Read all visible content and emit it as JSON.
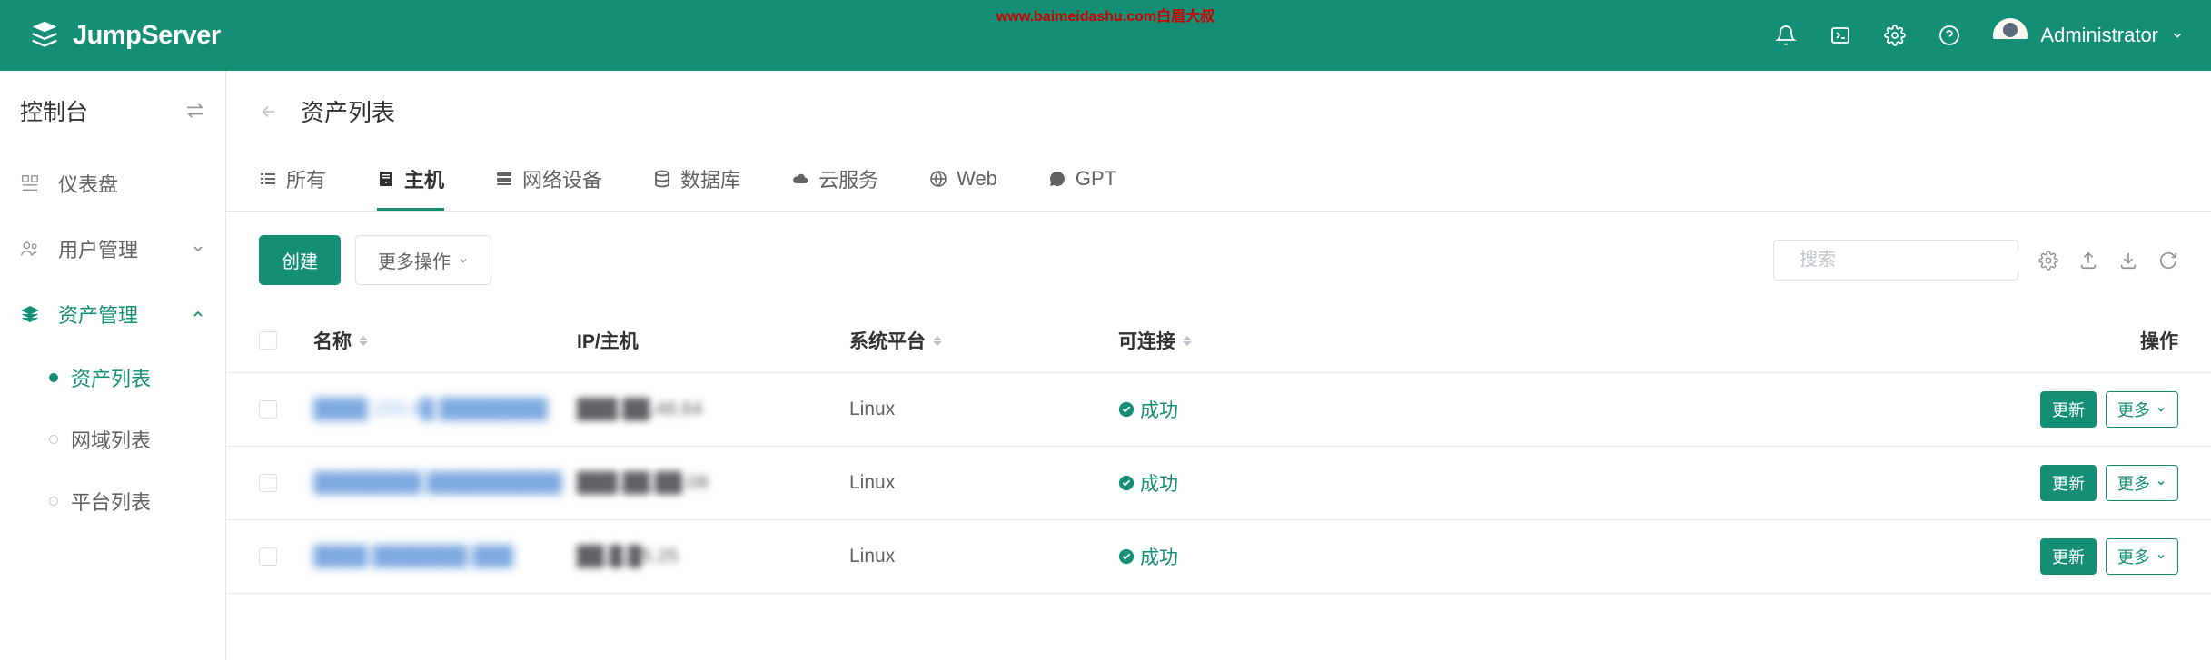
{
  "watermark": "www.baimeidashu.com白眉大叔",
  "header": {
    "logo_text": "JumpServer",
    "username": "Administrator"
  },
  "sidebar": {
    "header": "控制台",
    "items": [
      {
        "label": "仪表盘",
        "icon": "dashboard"
      },
      {
        "label": "用户管理",
        "icon": "users",
        "expandable": true
      },
      {
        "label": "资产管理",
        "icon": "layers",
        "expandable": true,
        "active": true
      }
    ],
    "sub_items": [
      {
        "label": "资产列表",
        "active": true
      },
      {
        "label": "网域列表"
      },
      {
        "label": "平台列表"
      }
    ]
  },
  "page": {
    "title": "资产列表"
  },
  "tabs": [
    {
      "label": "所有",
      "icon": "list"
    },
    {
      "label": "主机",
      "icon": "host",
      "active": true
    },
    {
      "label": "网络设备",
      "icon": "network"
    },
    {
      "label": "数据库",
      "icon": "database"
    },
    {
      "label": "云服务",
      "icon": "cloud"
    },
    {
      "label": "Web",
      "icon": "globe"
    },
    {
      "label": "GPT",
      "icon": "chat"
    }
  ],
  "toolbar": {
    "create_label": "创建",
    "more_label": "更多操作",
    "search_placeholder": "搜索"
  },
  "table": {
    "columns": {
      "name": "名称",
      "ip": "IP/主机",
      "platform": "系统平台",
      "connectable": "可连接",
      "actions": "操作"
    },
    "rows": [
      {
        "name": "████ 153.4█ ████████",
        "ip": "███.██.48.64",
        "platform": "Linux",
        "status": "成功"
      },
      {
        "name": "████████.██████████",
        "ip": "███.██.██.08",
        "platform": "Linux",
        "status": "成功"
      },
      {
        "name": "████.███████.███",
        "ip": "██.█.█5.25",
        "platform": "Linux",
        "status": "成功"
      }
    ],
    "action_update": "更新",
    "action_more": "更多"
  }
}
